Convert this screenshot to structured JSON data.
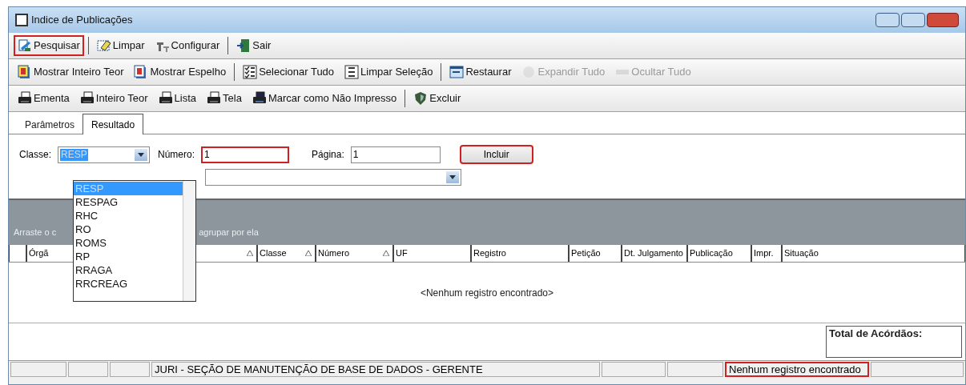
{
  "window": {
    "title": "Indice de Publicações"
  },
  "toolbars": [
    [
      {
        "label": "Pesquisar",
        "disabled": false,
        "separator_before": false,
        "highlighted": true
      },
      {
        "label": "Limpar",
        "disabled": false,
        "separator_before": true,
        "highlighted": false
      },
      {
        "label": "Configurar",
        "disabled": false,
        "separator_before": false,
        "highlighted": false
      },
      {
        "label": "Sair",
        "disabled": false,
        "separator_before": true,
        "highlighted": false
      }
    ],
    [
      {
        "label": "Mostrar Inteiro Teor",
        "disabled": false,
        "separator_before": false,
        "highlighted": false
      },
      {
        "label": "Mostrar Espelho",
        "disabled": false,
        "separator_before": false,
        "highlighted": false
      },
      {
        "label": "Selecionar Tudo",
        "disabled": false,
        "separator_before": true,
        "highlighted": false
      },
      {
        "label": "Limpar Seleção",
        "disabled": false,
        "separator_before": false,
        "highlighted": false
      },
      {
        "label": "Restaurar",
        "disabled": false,
        "separator_before": true,
        "highlighted": false
      },
      {
        "label": "Expandir Tudo",
        "disabled": true,
        "separator_before": false,
        "highlighted": false
      },
      {
        "label": "Ocultar Tudo",
        "disabled": true,
        "separator_before": false,
        "highlighted": false
      }
    ],
    [
      {
        "label": "Ementa",
        "disabled": false,
        "separator_before": false,
        "highlighted": false
      },
      {
        "label": "Inteiro Teor",
        "disabled": false,
        "separator_before": false,
        "highlighted": false
      },
      {
        "label": "Lista",
        "disabled": false,
        "separator_before": false,
        "highlighted": false
      },
      {
        "label": "Tela",
        "disabled": false,
        "separator_before": false,
        "highlighted": false
      },
      {
        "label": "Marcar como Não Impresso",
        "disabled": false,
        "separator_before": false,
        "highlighted": false
      },
      {
        "label": "Excluir",
        "disabled": false,
        "separator_before": true,
        "highlighted": false
      }
    ]
  ],
  "tabs": [
    {
      "label": "Parâmetros",
      "selected": false
    },
    {
      "label": "Resultado",
      "selected": true
    }
  ],
  "form": {
    "classe_label": "Classe:",
    "classe_value": "RESP",
    "numero_label": "Número:",
    "numero_value": "1",
    "numero_highlighted": true,
    "pagina_label": "Página:",
    "pagina_value": "1",
    "include_button": "Incluir",
    "include_highlighted": true,
    "classe_options": [
      {
        "label": "RESP",
        "selected": true
      },
      {
        "label": "RESPAG",
        "selected": false
      },
      {
        "label": "RHC",
        "selected": false
      },
      {
        "label": "RO",
        "selected": false
      },
      {
        "label": "ROMS",
        "selected": false
      },
      {
        "label": "RP",
        "selected": false
      },
      {
        "label": "RRAGA",
        "selected": false
      },
      {
        "label": "RRCREAG",
        "selected": false
      }
    ]
  },
  "group_panel": {
    "text_before": "Arraste o c",
    "text_after": "agrupar por ela"
  },
  "table": {
    "columns": [
      {
        "sort": false
      },
      {
        "label": "Órgã",
        "sort": true
      },
      {
        "label": "Classe",
        "sort": true
      },
      {
        "label": "Número",
        "sort": true
      },
      {
        "label": "UF",
        "sort": false
      },
      {
        "label": "Registro",
        "sort": false
      },
      {
        "label": "Petição",
        "sort": false
      },
      {
        "label": "Dt. Julgamento",
        "sort": false
      },
      {
        "label": "Publicação",
        "sort": false
      },
      {
        "label": "Impr.",
        "sort": false
      },
      {
        "label": "Situação",
        "sort": false
      }
    ],
    "empty_message": "<Nenhum registro encontrado>",
    "total_label": "Total de Acórdãos:"
  },
  "status_bar": [
    {
      "highlighted": false
    },
    {
      "highlighted": false
    },
    {
      "highlighted": false
    },
    {
      "text": "JURI - SEÇÃO DE MANUTENÇÃO DE BASE DE DADOS - GERENTE",
      "highlighted": false
    },
    {
      "highlighted": false
    },
    {
      "highlighted": false
    },
    {
      "text": "Nenhum registro encontrado",
      "highlighted": true
    },
    {
      "highlighted": false
    }
  ]
}
